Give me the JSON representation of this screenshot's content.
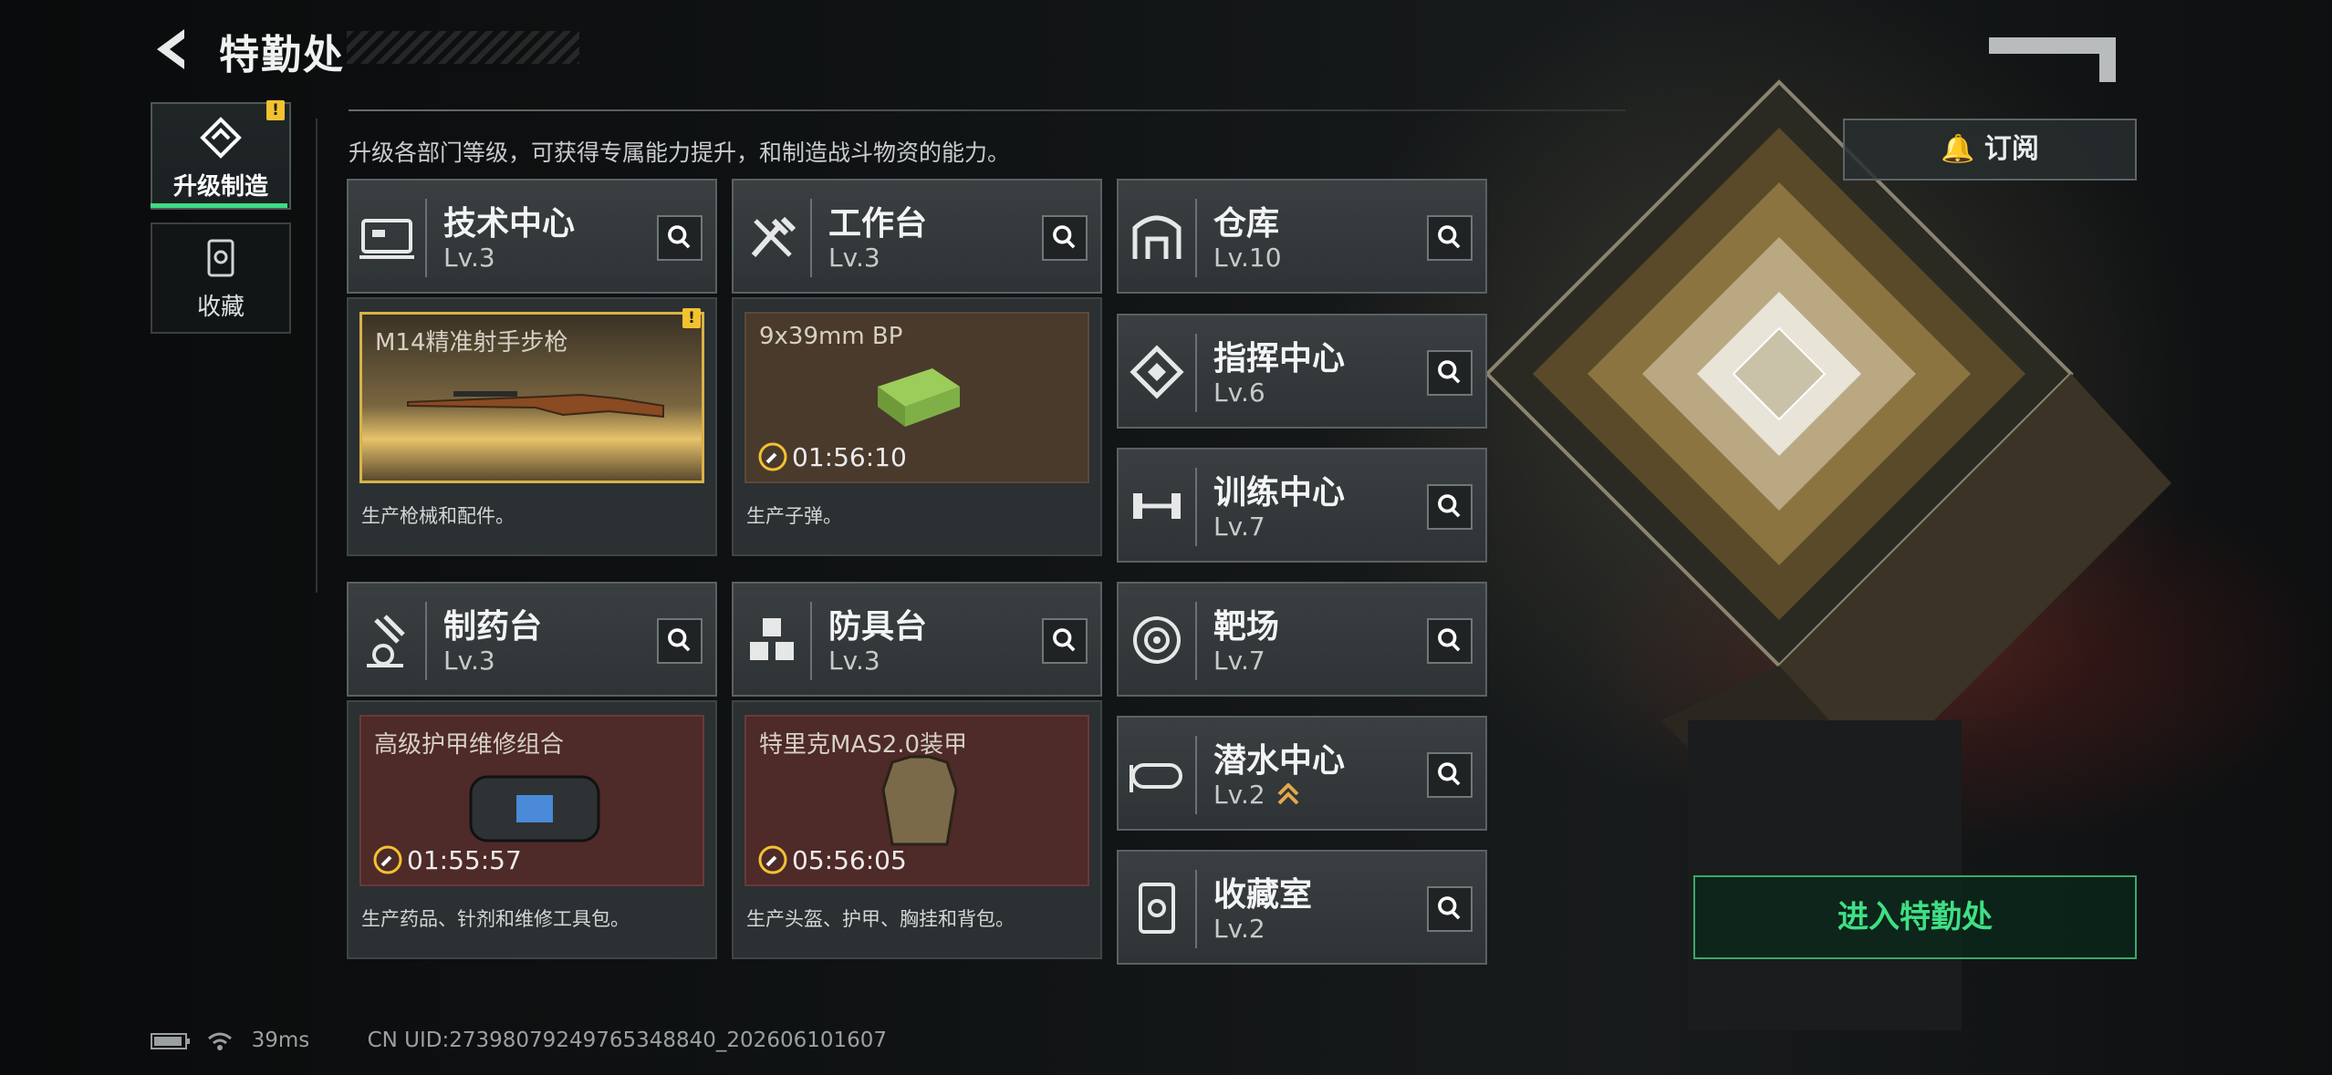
{
  "header": {
    "title": "特勤处"
  },
  "nav": [
    {
      "label": "升级制造",
      "active": true,
      "alert": "!"
    },
    {
      "label": "收藏",
      "active": false
    }
  ],
  "description": "升级各部门等级，可获得专属能力提升，和制造战斗物资的能力。",
  "departments": [
    {
      "name": "技术中心",
      "level": "Lv.3",
      "icon": "tech-center-icon"
    },
    {
      "name": "工作台",
      "level": "Lv.3",
      "icon": "workbench-icon"
    },
    {
      "name": "制药台",
      "level": "Lv.3",
      "icon": "pharmacy-icon"
    },
    {
      "name": "防具台",
      "level": "Lv.3",
      "icon": "armor-bench-icon"
    },
    {
      "name": "仓库",
      "level": "Lv.10",
      "icon": "warehouse-icon"
    },
    {
      "name": "指挥中心",
      "level": "Lv.6",
      "icon": "command-center-icon"
    },
    {
      "name": "训练中心",
      "level": "Lv.7",
      "icon": "training-center-icon"
    },
    {
      "name": "靶场",
      "level": "Lv.7",
      "icon": "shooting-range-icon"
    },
    {
      "name": "潜水中心",
      "level": "Lv.2",
      "icon": "diving-center-icon"
    },
    {
      "name": "收藏室",
      "level": "Lv.2",
      "icon": "collection-room-icon"
    }
  ],
  "production": [
    {
      "item": "M14精准射手步枪",
      "timer": "",
      "desc": "生产枪械和配件。",
      "alert": "!",
      "color": "#e3b84a"
    },
    {
      "item": "9x39mm BP",
      "timer": "01:56:10",
      "desc": "生产子弹。",
      "color": "#4a3a2c"
    },
    {
      "item": "高级护甲维修组合",
      "timer": "01:55:57",
      "desc": "生产药品、针剂和维修工具包。",
      "color": "#4e2a28"
    },
    {
      "item": "特里克MAS2.0装甲",
      "timer": "05:56:05",
      "desc": "生产头盔、护甲、胸挂和背包。",
      "color": "#4e2a28"
    }
  ],
  "buttons": {
    "subscribe": "订阅",
    "enter": "进入特勤处"
  },
  "status": {
    "ping": "39ms",
    "uid": "CN UID:2739807924976534884​0_202606101607"
  },
  "colors": {
    "accent": "#3ddc84",
    "alert": "#f2c230",
    "timer_ring": "#f2c230"
  }
}
